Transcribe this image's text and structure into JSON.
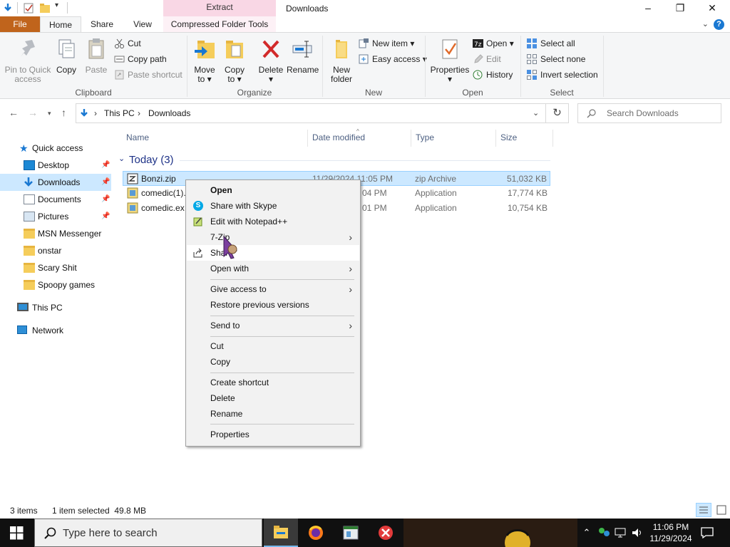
{
  "window": {
    "title": "Downloads",
    "contextual_header": "Extract",
    "controls": [
      "–",
      "❐",
      "✕"
    ]
  },
  "ribbon_tabs": {
    "file": "File",
    "home": "Home",
    "share": "Share",
    "view": "View",
    "compressed": "Compressed Folder Tools"
  },
  "ribbon": {
    "clipboard": {
      "group": "Clipboard",
      "pin_line1": "Pin to Quick",
      "pin_line2": "access",
      "copy": "Copy",
      "paste": "Paste",
      "cut": "Cut",
      "copy_path": "Copy path",
      "paste_shortcut": "Paste shortcut"
    },
    "organize": {
      "group": "Organize",
      "move1": "Move",
      "move2": "to ▾",
      "copy1": "Copy",
      "copy2": "to ▾",
      "delete": "Delete",
      "delete_caret": "▾",
      "rename": "Rename"
    },
    "new": {
      "group": "New",
      "folder1": "New",
      "folder2": "folder",
      "new_item": "New item ▾",
      "easy_access": "Easy access ▾"
    },
    "open": {
      "group": "Open",
      "properties": "Properties",
      "properties_caret": "▾",
      "open": "Open ▾",
      "edit": "Edit",
      "history": "History"
    },
    "select": {
      "group": "Select",
      "select_all": "Select all",
      "select_none": "Select none",
      "invert": "Invert selection"
    }
  },
  "address": {
    "crumbs": [
      "This PC",
      "Downloads"
    ],
    "separator": "›",
    "search_placeholder": "Search Downloads"
  },
  "nav_pane": {
    "quick_access": "Quick access",
    "items": [
      {
        "label": "Desktop",
        "pinned": true
      },
      {
        "label": "Downloads",
        "pinned": true
      },
      {
        "label": "Documents",
        "pinned": true
      },
      {
        "label": "Pictures",
        "pinned": true
      },
      {
        "label": "MSN Messenger",
        "pinned": false
      },
      {
        "label": "onstar",
        "pinned": false
      },
      {
        "label": "Scary Shit",
        "pinned": false
      },
      {
        "label": "Spoopy games",
        "pinned": false
      }
    ],
    "this_pc": "This PC",
    "network": "Network"
  },
  "file_list": {
    "columns": {
      "name": "Name",
      "date": "Date modified",
      "type": "Type",
      "size": "Size"
    },
    "group_label": "Today (3)",
    "rows": [
      {
        "name": "Bonzi.zip",
        "date": "11/29/2024 11:05 PM",
        "type": "zip Archive",
        "size": "51,032 KB"
      },
      {
        "name": "comedic(1).",
        "date": "04 PM",
        "type": "Application",
        "size": "17,774 KB"
      },
      {
        "name": "comedic.ex",
        "date": "01 PM",
        "type": "Application",
        "size": "10,754 KB"
      }
    ]
  },
  "context_menu": {
    "open": "Open",
    "share_skype": "Share with Skype",
    "edit_npp": "Edit with Notepad++",
    "seven_zip": "7-Zip",
    "share": "Share",
    "open_with": "Open with",
    "give_access": "Give access to",
    "restore": "Restore previous versions",
    "send_to": "Send to",
    "cut": "Cut",
    "copy": "Copy",
    "create_shortcut": "Create shortcut",
    "delete": "Delete",
    "rename": "Rename",
    "properties": "Properties",
    "arrow": "›"
  },
  "status_bar": {
    "items": "3 items",
    "selected": "1 item selected  49.8 MB"
  },
  "taskbar": {
    "search_placeholder": "Type here to search",
    "time": "11:06 PM",
    "date": "11/29/2024"
  },
  "colors": {
    "file_tab": "#c0641c",
    "contextual_tab": "#f9d7e5",
    "selection": "#cce8ff",
    "accent_blue": "#1978d2",
    "taskbar": "#101010"
  }
}
